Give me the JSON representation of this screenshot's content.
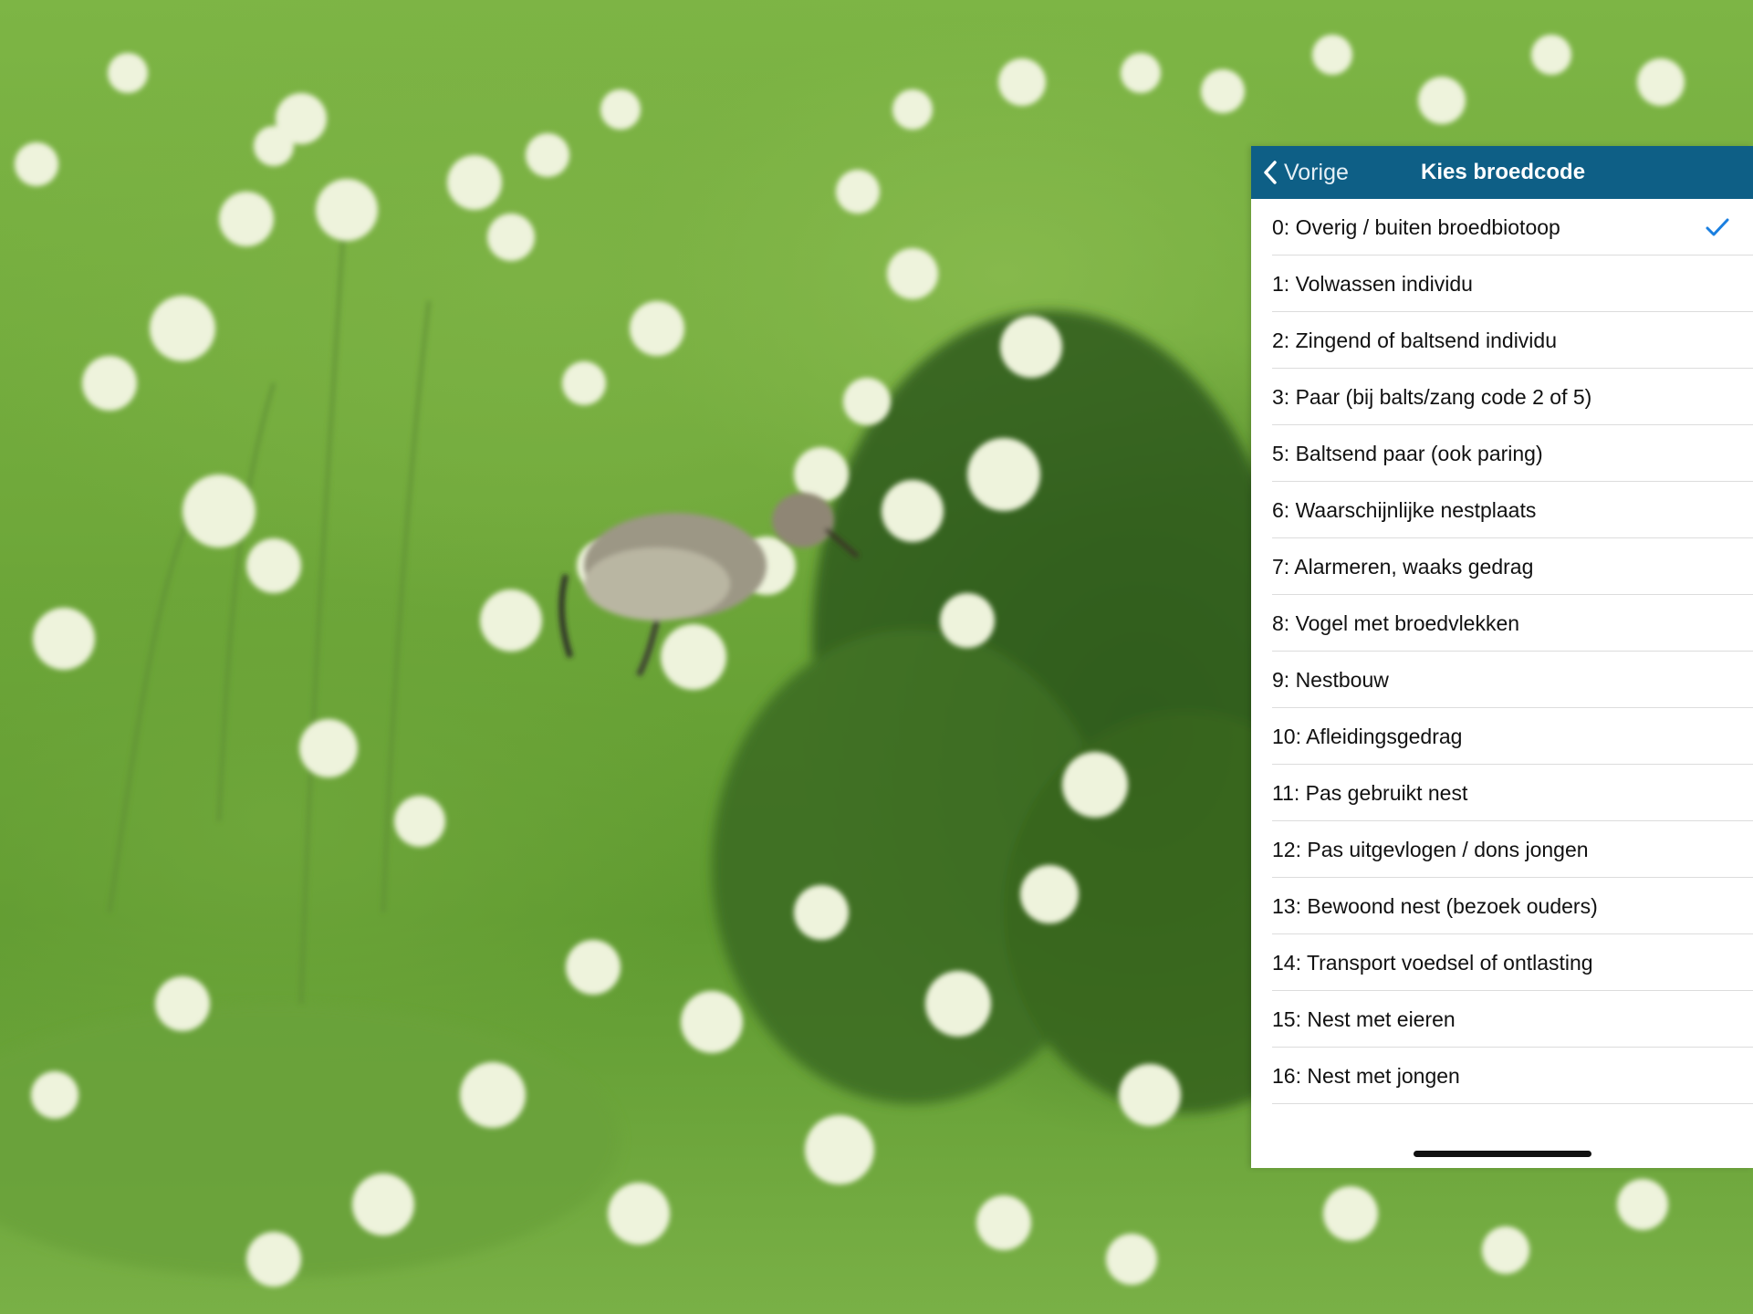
{
  "nav": {
    "back_label": "Vorige",
    "title": "Kies broedcode"
  },
  "codes": [
    {
      "label": "0: Overig / buiten broedbiotoop",
      "selected": true
    },
    {
      "label": "1: Volwassen individu"
    },
    {
      "label": "2: Zingend of baltsend individu"
    },
    {
      "label": "3: Paar (bij balts/zang code 2 of 5)"
    },
    {
      "label": "5: Baltsend paar (ook paring)"
    },
    {
      "label": "6: Waarschijnlijke nestplaats"
    },
    {
      "label": "7: Alarmeren, waaks gedrag"
    },
    {
      "label": "8: Vogel met broedvlekken"
    },
    {
      "label": "9: Nestbouw"
    },
    {
      "label": "10: Afleidingsgedrag"
    },
    {
      "label": "11: Pas gebruikt nest"
    },
    {
      "label": "12: Pas uitgevlogen / dons jongen"
    },
    {
      "label": "13: Bewoond nest (bezoek ouders)"
    },
    {
      "label": "14: Transport voedsel of ontlasting"
    },
    {
      "label": "15: Nest met eieren"
    },
    {
      "label": "16: Nest met jongen"
    }
  ],
  "colors": {
    "navbar": "#0e5f86",
    "checkmark": "#1a7fe0"
  },
  "icons": {
    "back": "chevron-left-icon",
    "selected": "checkmark-icon"
  }
}
